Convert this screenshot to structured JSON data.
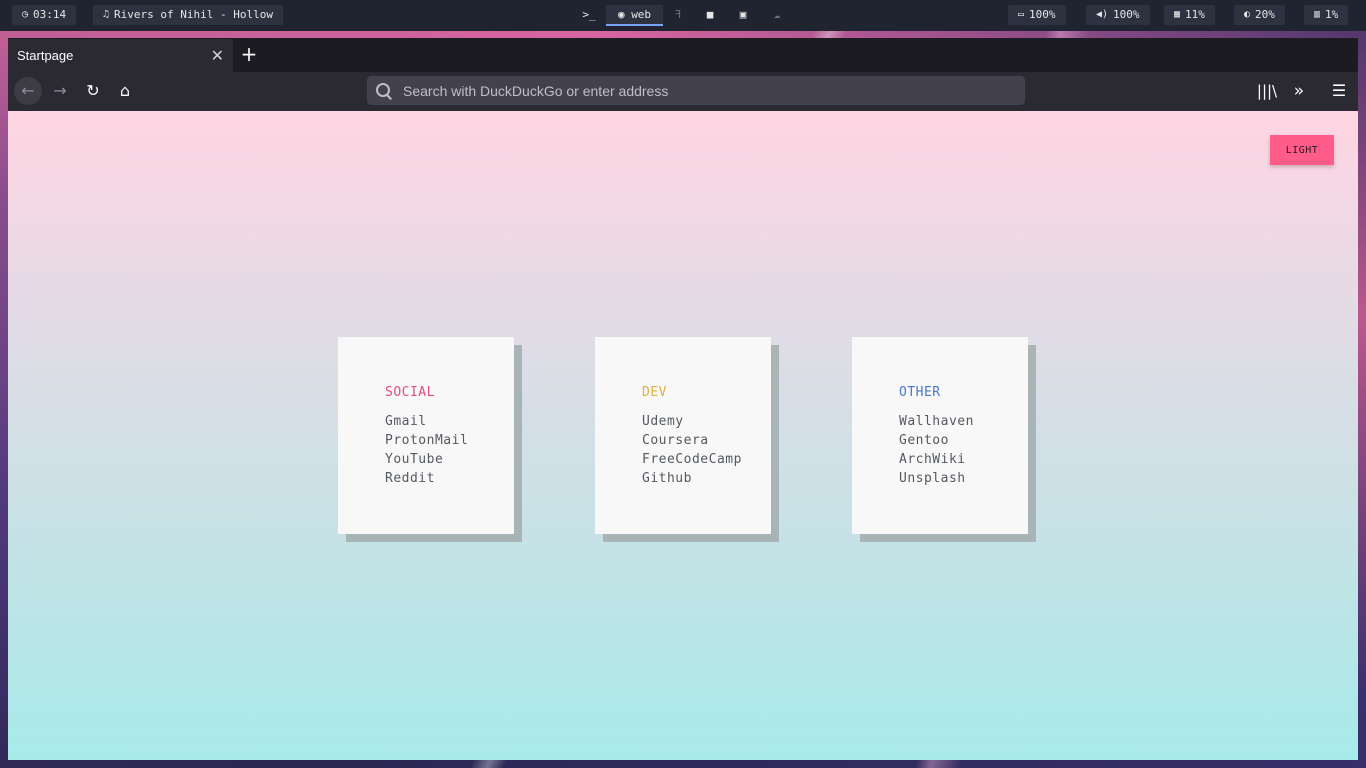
{
  "topbar": {
    "clock": "03:14",
    "now_playing": "Rivers of Nihil - Hollow",
    "workspaces": [
      {
        "label": ">_",
        "icon": "terminal-icon",
        "active": false
      },
      {
        "label": "web",
        "icon": "globe-icon",
        "active": true
      },
      {
        "label": "ꟻ",
        "icon": "git-icon",
        "active": false
      },
      {
        "label": "■",
        "icon": "folder-icon",
        "active": false
      },
      {
        "label": "▣",
        "icon": "media-icon",
        "active": false
      },
      {
        "label": "☁",
        "icon": "cloud-icon",
        "active": false
      }
    ],
    "battery": "100%",
    "volume": "100%",
    "memory": "11%",
    "brightness": "20%",
    "cpu": "1%"
  },
  "browser": {
    "tab_title": "Startpage",
    "url_placeholder": "Search with DuckDuckGo or enter address"
  },
  "page": {
    "theme_button": "LIGHT",
    "cards": [
      {
        "title": "SOCIAL",
        "color": "#e0507a",
        "links": [
          "Gmail",
          "ProtonMail",
          "YouTube",
          "Reddit"
        ]
      },
      {
        "title": "DEV",
        "color": "#e0b040",
        "links": [
          "Udemy",
          "Coursera",
          "FreeCodeCamp",
          "Github"
        ]
      },
      {
        "title": "OTHER",
        "color": "#4a78c8",
        "links": [
          "Wallhaven",
          "Gentoo",
          "ArchWiki",
          "Unsplash"
        ]
      }
    ]
  }
}
